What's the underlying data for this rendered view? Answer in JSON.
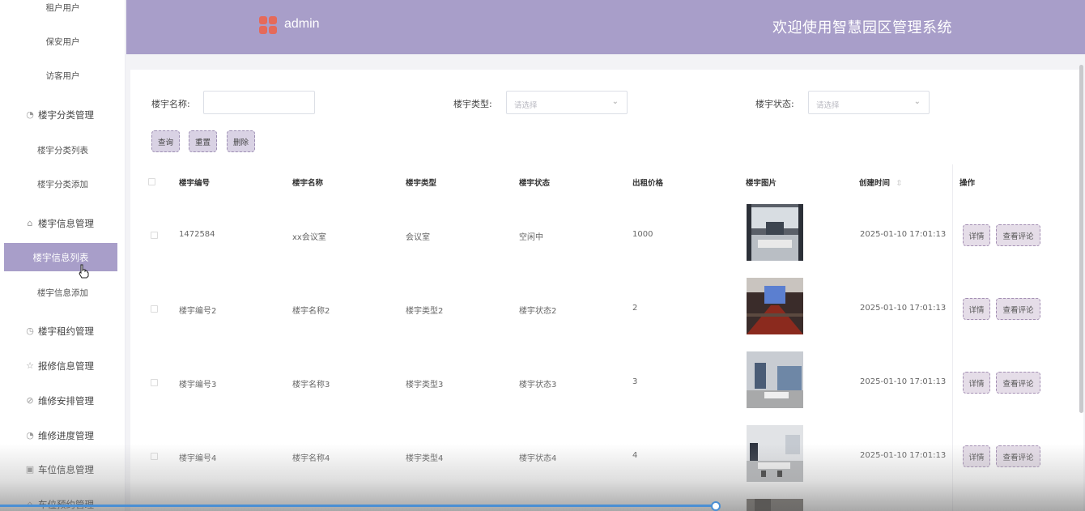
{
  "sidebar": {
    "items": [
      {
        "label": "租户用户",
        "type": "sub"
      },
      {
        "label": "保安用户",
        "type": "sub"
      },
      {
        "label": "访客用户",
        "type": "sub"
      },
      {
        "label": "楼宇分类管理",
        "type": "group",
        "icon": "pie-icon"
      },
      {
        "label": "楼宇分类列表",
        "type": "sub"
      },
      {
        "label": "楼宇分类添加",
        "type": "sub"
      },
      {
        "label": "楼宇信息管理",
        "type": "group",
        "icon": "building-icon"
      },
      {
        "label": "楼宇信息列表",
        "type": "active"
      },
      {
        "label": "楼宇信息添加",
        "type": "sub"
      },
      {
        "label": "楼宇租约管理",
        "type": "group",
        "icon": "clock-icon"
      },
      {
        "label": "报修信息管理",
        "type": "group",
        "icon": "star-icon"
      },
      {
        "label": "维修安排管理",
        "type": "group",
        "icon": "compass-icon"
      },
      {
        "label": "维修进度管理",
        "type": "group",
        "icon": "pie-icon"
      },
      {
        "label": "车位信息管理",
        "type": "group",
        "icon": "calendar-icon"
      },
      {
        "label": "车位预约管理",
        "type": "group",
        "icon": "building-icon"
      }
    ]
  },
  "header": {
    "user": "admin",
    "welcome": "欢迎使用智慧园区管理系统"
  },
  "search": {
    "name_label": "楼宇名称:",
    "name_value": "",
    "type_label": "楼宇类型:",
    "type_placeholder": "请选择",
    "status_label": "楼宇状态:",
    "status_placeholder": "请选择",
    "query_btn": "查询",
    "reset_btn": "重置",
    "delete_btn": "删除"
  },
  "table": {
    "headers": [
      "楼宇编号",
      "楼宇名称",
      "楼宇类型",
      "楼宇状态",
      "出租价格",
      "楼宇图片",
      "创建时间",
      "操作"
    ],
    "sort_icon": "⇳",
    "detail_btn": "详情",
    "comment_btn": "查看评论",
    "rows": [
      {
        "code": "1472584",
        "name": "xx会议室",
        "type": "会议室",
        "status": "空闲中",
        "price": "1000",
        "created": "2025-01-10 17:01:13"
      },
      {
        "code": "楼宇编号2",
        "name": "楼宇名称2",
        "type": "楼宇类型2",
        "status": "楼宇状态2",
        "price": "2",
        "created": "2025-01-10 17:01:13"
      },
      {
        "code": "楼宇编号3",
        "name": "楼宇名称3",
        "type": "楼宇类型3",
        "status": "楼宇状态3",
        "price": "3",
        "created": "2025-01-10 17:01:13"
      },
      {
        "code": "楼宇编号4",
        "name": "楼宇名称4",
        "type": "楼宇类型4",
        "status": "楼宇状态4",
        "price": "4",
        "created": "2025-01-10 17:01:13"
      }
    ]
  },
  "colors": {
    "accent": "#a89ec9",
    "button_bg": "#d9d2e4",
    "button_border": "#9c8eb2"
  }
}
